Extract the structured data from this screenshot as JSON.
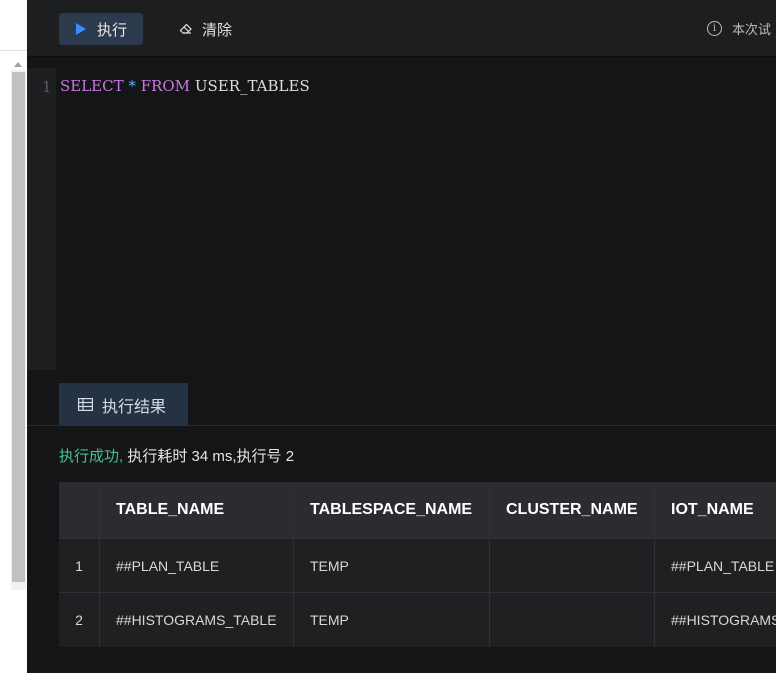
{
  "toolbar": {
    "run_label": "执行",
    "clear_label": "清除",
    "info_text": "本次试"
  },
  "editor": {
    "line_number": "1",
    "code": {
      "kw_select": "SELECT",
      "star": "*",
      "kw_from": "FROM",
      "table": "USER_TABLES"
    }
  },
  "results": {
    "tab_label": "执行结果",
    "status_ok": "执行成功,",
    "status_detail": "执行耗时 34 ms,执行号 2",
    "columns": [
      "",
      "TABLE_NAME",
      "TABLESPACE_NAME",
      "CLUSTER_NAME",
      "IOT_NAME"
    ],
    "rows": [
      [
        "1",
        "##PLAN_TABLE",
        "TEMP",
        "",
        "##PLAN_TABLE"
      ],
      [
        "2",
        "##HISTOGRAMS_TABLE",
        "TEMP",
        "",
        "##HISTOGRAMS_TABLE"
      ]
    ]
  },
  "colors": {
    "run_icon": "#3b8cff",
    "success": "#3fc48f",
    "keyword": "#c678dd",
    "operator": "#61afef"
  },
  "icons": [
    "play-icon",
    "eraser-icon",
    "info-icon",
    "table-grid-icon"
  ]
}
